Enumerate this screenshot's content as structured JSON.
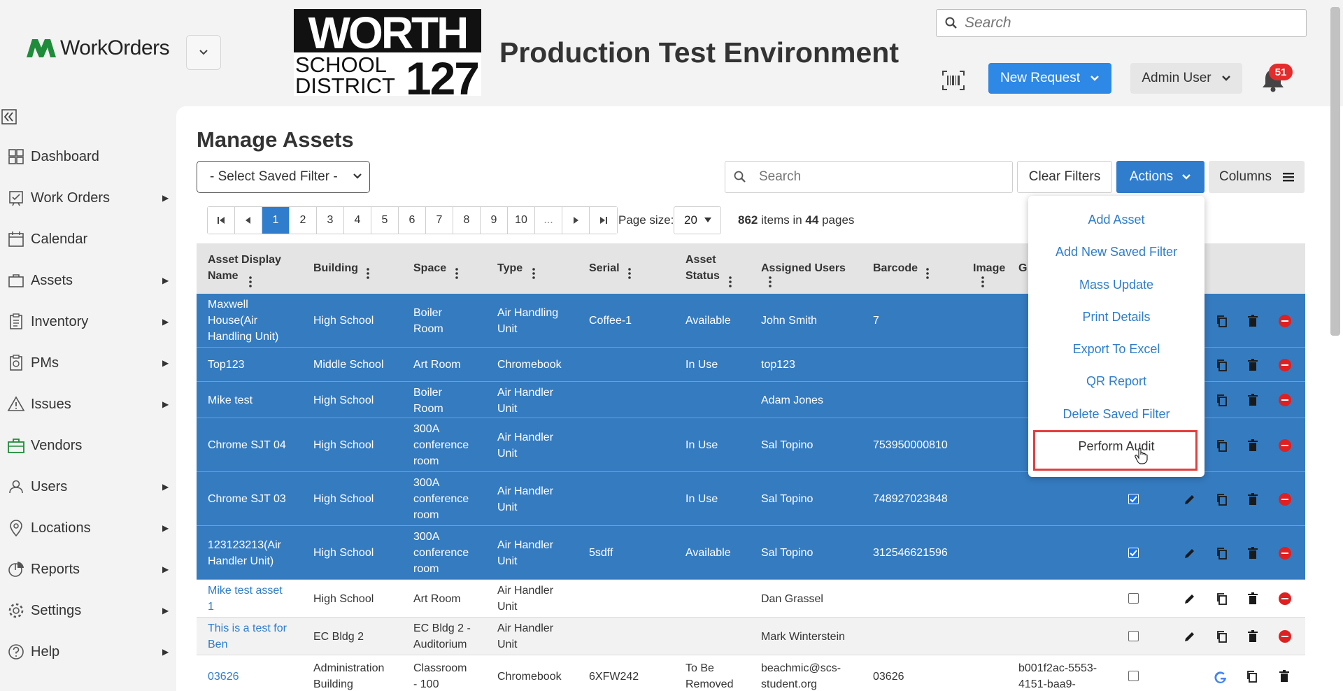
{
  "header": {
    "app_name": "WorkOrders",
    "district_logo": {
      "line1": "WORTH",
      "line2": "SCHOOL",
      "line3": "DISTRICT",
      "number": "127"
    },
    "environment_title": "Production Test Environment",
    "search_placeholder": "Search",
    "new_request_label": "New Request",
    "user_label": "Admin User",
    "notifications_count": "51"
  },
  "sidebar": {
    "items": [
      {
        "label": "Dashboard",
        "icon": "dashboard-icon",
        "has_submenu": false
      },
      {
        "label": "Work Orders",
        "icon": "work-orders-icon",
        "has_submenu": true
      },
      {
        "label": "Calendar",
        "icon": "calendar-icon",
        "has_submenu": false
      },
      {
        "label": "Assets",
        "icon": "assets-icon",
        "has_submenu": true
      },
      {
        "label": "Inventory",
        "icon": "inventory-icon",
        "has_submenu": true
      },
      {
        "label": "PMs",
        "icon": "pms-icon",
        "has_submenu": true
      },
      {
        "label": "Issues",
        "icon": "issues-icon",
        "has_submenu": true
      },
      {
        "label": "Vendors",
        "icon": "vendors-icon",
        "has_submenu": false
      },
      {
        "label": "Users",
        "icon": "users-icon",
        "has_submenu": true
      },
      {
        "label": "Locations",
        "icon": "locations-icon",
        "has_submenu": true
      },
      {
        "label": "Reports",
        "icon": "reports-icon",
        "has_submenu": true
      },
      {
        "label": "Settings",
        "icon": "settings-icon",
        "has_submenu": true
      },
      {
        "label": "Help",
        "icon": "help-icon",
        "has_submenu": true
      }
    ]
  },
  "main": {
    "title": "Manage Assets",
    "saved_filter_value": "- Select Saved Filter -",
    "search_placeholder": "Search",
    "clear_filters_label": "Clear Filters",
    "actions_label": "Actions",
    "columns_label": "Columns"
  },
  "pager": {
    "pages": [
      "1",
      "2",
      "3",
      "4",
      "5",
      "6",
      "7",
      "8",
      "9",
      "10",
      "..."
    ],
    "active_page": "1",
    "page_size_label": "Page size:",
    "page_size_value": "20",
    "items_count": "862",
    "items_text": "items in",
    "pages_count": "44",
    "pages_text": "pages"
  },
  "table": {
    "columns": [
      {
        "l1": "Asset Display",
        "l2": "Name"
      },
      {
        "l1": "Building",
        "l2": ""
      },
      {
        "l1": "Space",
        "l2": ""
      },
      {
        "l1": "Type",
        "l2": ""
      },
      {
        "l1": "Serial",
        "l2": ""
      },
      {
        "l1": "Asset",
        "l2": "Status"
      },
      {
        "l1": "Assigned Users",
        "l2": ""
      },
      {
        "l1": "Barcode",
        "l2": ""
      },
      {
        "l1": "Image",
        "l2": ""
      },
      {
        "l1": "G",
        "l2": ""
      }
    ],
    "rows": [
      {
        "name": [
          "Maxwell",
          "House(Air",
          "Handling Unit)"
        ],
        "building": [
          "High School"
        ],
        "space": [
          "Boiler",
          "Room"
        ],
        "type": [
          "Air Handling",
          "Unit"
        ],
        "serial": "Coffee-1",
        "status": [
          "Available"
        ],
        "users": [
          "John Smith"
        ],
        "barcode": "7",
        "extra": [],
        "selected": true
      },
      {
        "name": [
          "Top123"
        ],
        "building": [
          "Middle School"
        ],
        "space": [
          "Art Room"
        ],
        "type": [
          "Chromebook"
        ],
        "serial": "",
        "status": [
          "In Use"
        ],
        "users": [
          "top123"
        ],
        "barcode": "",
        "extra": [],
        "selected": true
      },
      {
        "name": [
          "Mike test"
        ],
        "building": [
          "High School"
        ],
        "space": [
          "Boiler",
          "Room"
        ],
        "type": [
          "Air Handler",
          "Unit"
        ],
        "serial": "",
        "status": [],
        "users": [
          "Adam Jones"
        ],
        "barcode": "",
        "extra": [],
        "selected": true
      },
      {
        "name": [
          "Chrome SJT 04"
        ],
        "building": [
          "High School"
        ],
        "space": [
          "300A",
          "conference",
          "room"
        ],
        "type": [
          "Air Handler",
          "Unit"
        ],
        "serial": "",
        "status": [
          "In Use"
        ],
        "users": [
          "Sal Topino"
        ],
        "barcode": "753950000810",
        "extra": [],
        "selected": true
      },
      {
        "name": [
          "Chrome SJT 03"
        ],
        "building": [
          "High School"
        ],
        "space": [
          "300A",
          "conference",
          "room"
        ],
        "type": [
          "Air Handler",
          "Unit"
        ],
        "serial": "",
        "status": [
          "In Use"
        ],
        "users": [
          "Sal Topino"
        ],
        "barcode": "748927023848",
        "extra": [],
        "selected": true
      },
      {
        "name": [
          "123123213(Air",
          "Handler Unit)"
        ],
        "building": [
          "High School"
        ],
        "space": [
          "300A",
          "conference",
          "room"
        ],
        "type": [
          "Air Handler",
          "Unit"
        ],
        "serial": "5sdff",
        "status": [
          "Available"
        ],
        "users": [
          "Sal Topino"
        ],
        "barcode": "312546621596",
        "extra": [],
        "selected": true
      },
      {
        "name": [
          "Mike test asset",
          "1"
        ],
        "building": [
          "High School"
        ],
        "space": [
          "Art Room"
        ],
        "type": [
          "Air Handler",
          "Unit"
        ],
        "serial": "",
        "status": [],
        "users": [
          "Dan Grassel"
        ],
        "barcode": "",
        "extra": [],
        "selected": false
      },
      {
        "name": [
          "This is a test for",
          "Ben"
        ],
        "building": [
          "EC Bldg 2"
        ],
        "space": [
          "EC Bldg 2 -",
          "Auditorium"
        ],
        "type": [
          "Air Handler",
          "Unit"
        ],
        "serial": "",
        "status": [],
        "users": [
          "Mark Winterstein"
        ],
        "barcode": "",
        "extra": [],
        "selected": false
      },
      {
        "name": [
          "03626"
        ],
        "building": [
          "Administration",
          "Building"
        ],
        "space": [
          "Classroom",
          "- 100"
        ],
        "type": [
          "Chromebook"
        ],
        "serial": "6XFW242",
        "status": [
          "To Be",
          "Removed"
        ],
        "users": [
          "beachmic@scs-",
          "student.org"
        ],
        "barcode": "03626",
        "extra": [
          "b001f2ac-5553-",
          "4151-baa9-"
        ],
        "selected": false
      }
    ]
  },
  "actions_menu": {
    "items": [
      "Add Asset",
      "Add New Saved Filter",
      "Mass Update",
      "Print Details",
      "Export To Excel",
      "QR Report",
      "Delete Saved Filter",
      "Perform Audit"
    ],
    "highlighted_item": "Perform Audit"
  },
  "colors": {
    "primary": "#2f7dcc",
    "selected_row": "#357bc0",
    "logo_green": "#1e8c3a",
    "badge_red": "#e52b2b",
    "highlight_box": "#e43d3d"
  }
}
